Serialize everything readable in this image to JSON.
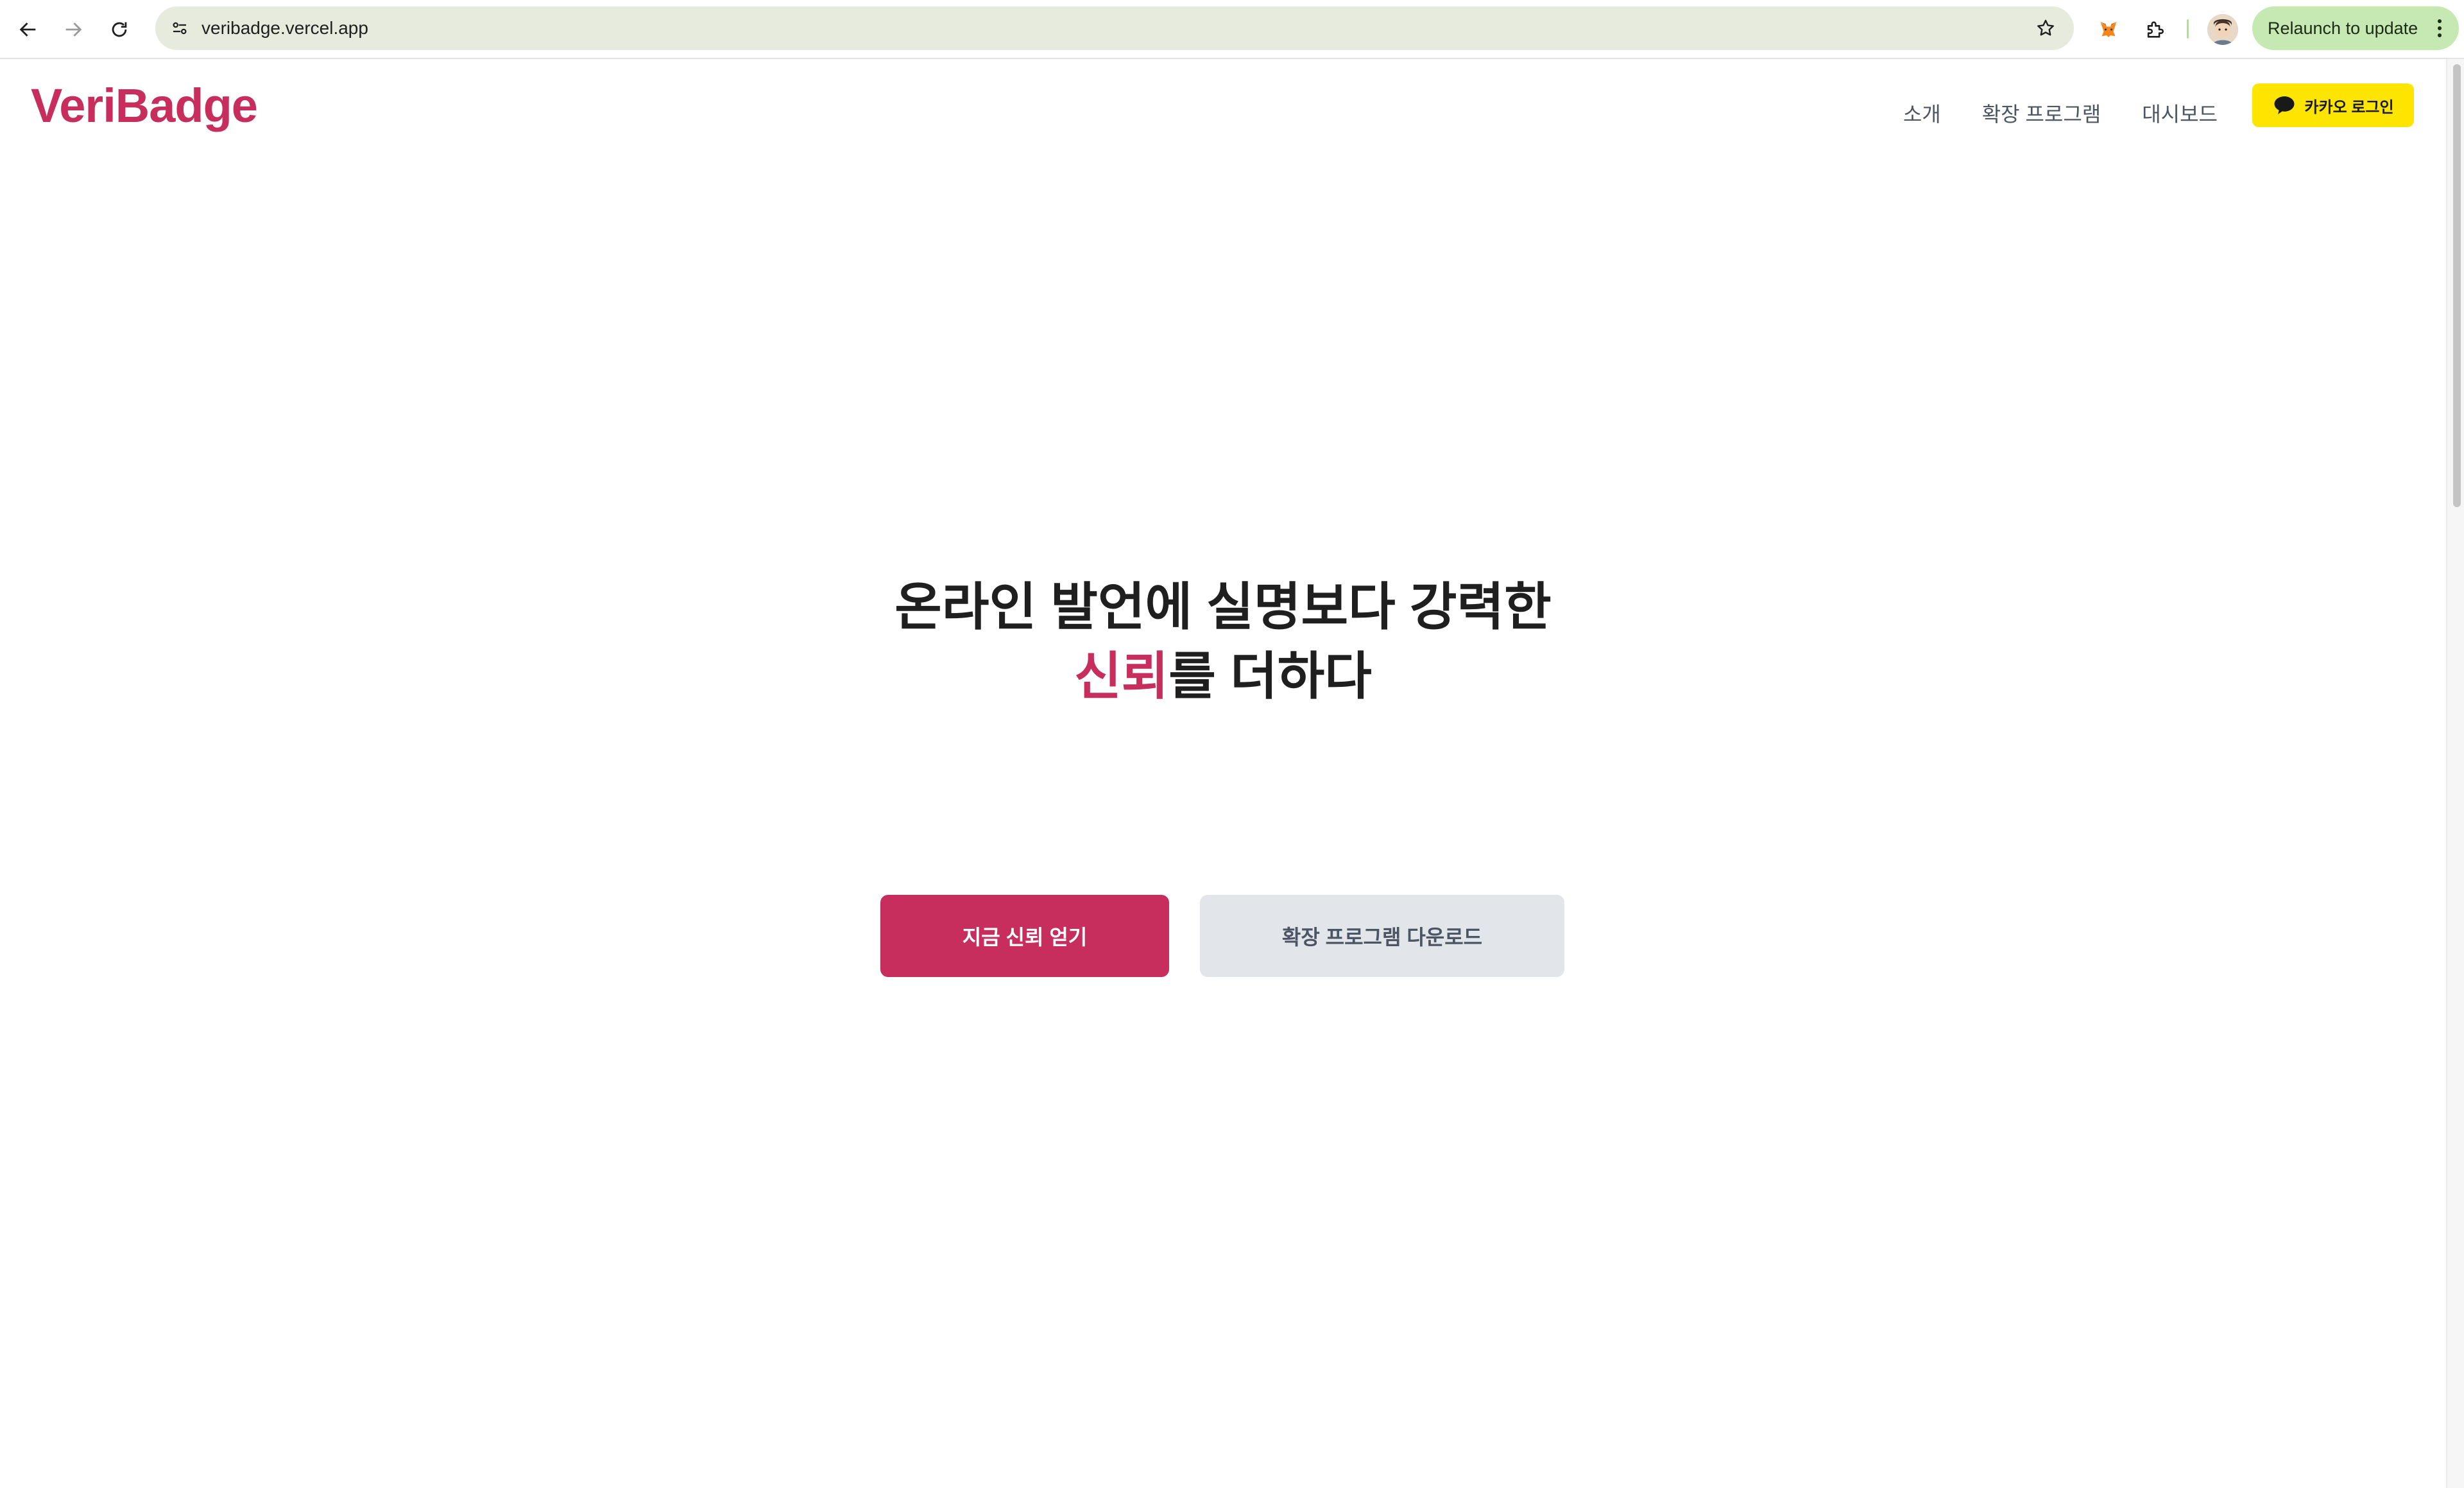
{
  "browser": {
    "url": "veribadge.vercel.app",
    "relaunch_label": "Relaunch to update"
  },
  "site": {
    "logo": "VeriBadge",
    "nav": {
      "about": "소개",
      "extension": "확장 프로그램",
      "dashboard": "대시보드",
      "kakao_login": "카카오 로그인"
    },
    "hero": {
      "line1": "온라인 발언에 실명보다 강력한",
      "line2_accent": "신뢰",
      "line2_rest": "를 더하다"
    },
    "cta": {
      "primary": "지금 신뢰 얻기",
      "secondary": "확장 프로그램 다운로드"
    }
  },
  "colors": {
    "brand": "#c72e5d",
    "kakao": "#fee500",
    "secondary_button": "#e2e5ea",
    "omnibox": "#e6ebde",
    "relaunch": "#c6e9b3"
  }
}
